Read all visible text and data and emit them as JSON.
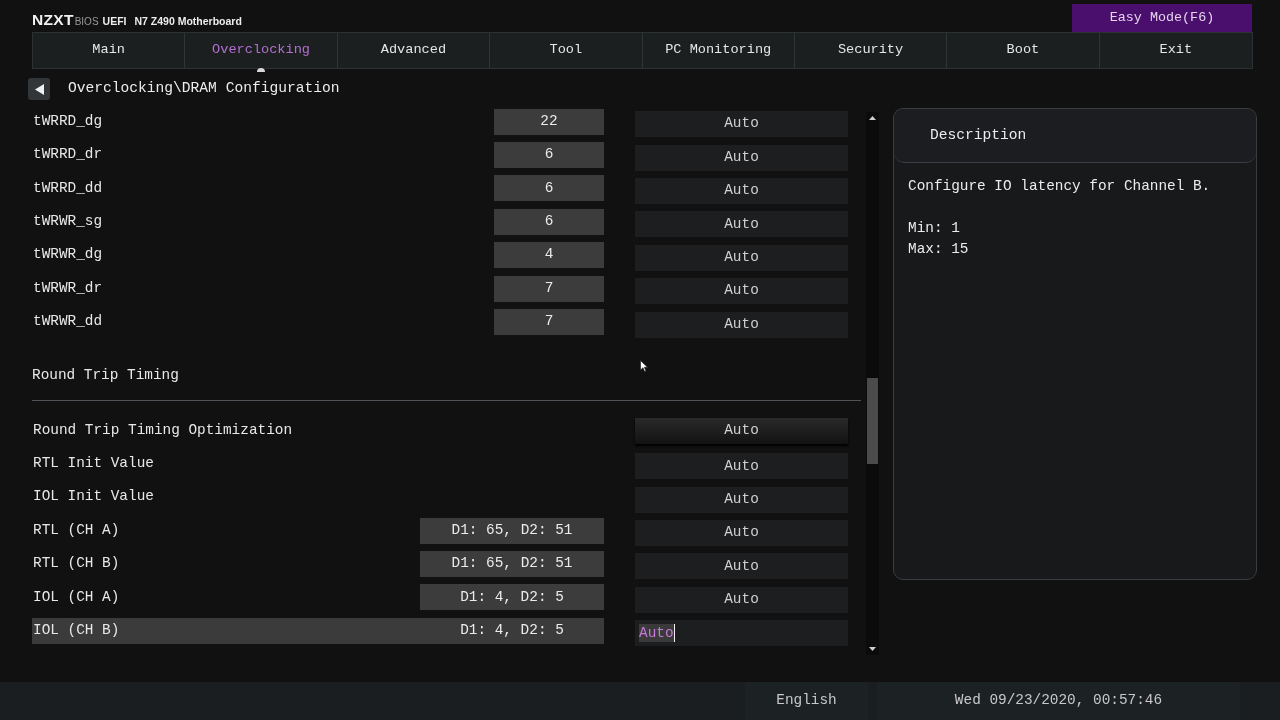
{
  "header": {
    "brand": "NZXT",
    "brand_suffix": "BIOS",
    "firmware": "UEFI",
    "board": "N7 Z490 Motherboard",
    "mode_button": "Easy Mode(F6)"
  },
  "tabs": [
    {
      "label": "Main",
      "selected": false
    },
    {
      "label": "Overclocking",
      "selected": true
    },
    {
      "label": "Advanced",
      "selected": false
    },
    {
      "label": "Tool",
      "selected": false
    },
    {
      "label": "PC Monitoring",
      "selected": false
    },
    {
      "label": "Security",
      "selected": false
    },
    {
      "label": "Boot",
      "selected": false
    },
    {
      "label": "Exit",
      "selected": false
    }
  ],
  "breadcrumb": "Overclocking\\DRAM Configuration",
  "settings": [
    {
      "kind": "field",
      "name": "tWRRD_dg",
      "current": "22",
      "value": "Auto",
      "selected": false
    },
    {
      "kind": "field",
      "name": "tWRRD_dr",
      "current": "6",
      "value": "Auto",
      "selected": false
    },
    {
      "kind": "field",
      "name": "tWRRD_dd",
      "current": "6",
      "value": "Auto",
      "selected": false
    },
    {
      "kind": "field",
      "name": "tWRWR_sg",
      "current": "6",
      "value": "Auto",
      "selected": false
    },
    {
      "kind": "field",
      "name": "tWRWR_dg",
      "current": "4",
      "value": "Auto",
      "selected": false
    },
    {
      "kind": "field",
      "name": "tWRWR_dr",
      "current": "7",
      "value": "Auto",
      "selected": false
    },
    {
      "kind": "field",
      "name": "tWRWR_dd",
      "current": "7",
      "value": "Auto",
      "selected": false
    },
    {
      "kind": "section",
      "title": "Round Trip Timing"
    },
    {
      "kind": "dropdown",
      "name": "Round Trip Timing Optimization",
      "value": "Auto",
      "selected": false
    },
    {
      "kind": "field",
      "name": "RTL Init Value",
      "value": "Auto",
      "selected": false
    },
    {
      "kind": "field",
      "name": "IOL Init Value",
      "value": "Auto",
      "selected": false
    },
    {
      "kind": "field",
      "name": "RTL (CH A)",
      "current": "D1: 65, D2: 51",
      "value": "Auto",
      "selected": false
    },
    {
      "kind": "field",
      "name": "RTL (CH B)",
      "current": "D1: 65, D2: 51",
      "value": "Auto",
      "selected": false
    },
    {
      "kind": "field",
      "name": "IOL (CH A)",
      "current": "D1: 4, D2: 5",
      "value": "Auto",
      "selected": false
    },
    {
      "kind": "field",
      "name": "IOL (CH B)",
      "current": "D1: 4, D2: 5",
      "value": "Auto",
      "selected": true
    }
  ],
  "description": {
    "title": "Description",
    "paragraphs": [
      [
        "Configure IO latency for Channel B."
      ],
      [
        "Min: 1",
        "Max: 15"
      ]
    ]
  },
  "status_bar": {
    "language": "English",
    "datetime": "Wed 09/23/2020, 00:57:46"
  }
}
